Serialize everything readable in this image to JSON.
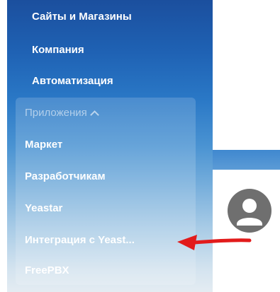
{
  "sidebar": {
    "items": [
      {
        "label": "Сайты и Магазины"
      },
      {
        "label": "Компания"
      },
      {
        "label": "Автоматизация"
      }
    ],
    "group": {
      "label": "Приложения",
      "expanded": true,
      "items": [
        {
          "label": "Маркет"
        },
        {
          "label": "Разработчикам"
        },
        {
          "label": "Yeastar"
        },
        {
          "label": "Интеграция с Yeast..."
        },
        {
          "label": "FreePBX"
        }
      ]
    }
  },
  "icons": {
    "group_toggle": "chevron-up-icon",
    "avatar": "user-icon",
    "annotation": "red-arrow-icon"
  },
  "colors": {
    "sidebar_top": "#1b4f9e",
    "sidebar_bottom": "#e4ecf2",
    "arrow": "#e21b1b",
    "avatar": "#6f6f6f"
  }
}
